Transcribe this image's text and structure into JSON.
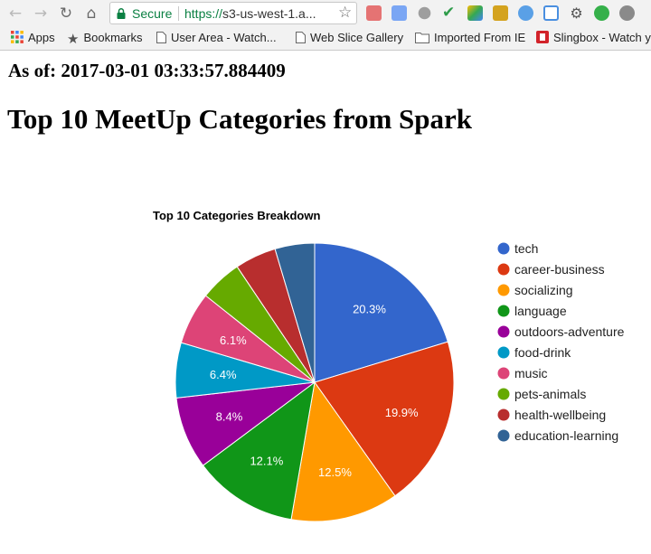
{
  "browser": {
    "secure_label": "Secure",
    "url_scheme": "https://",
    "url_rest": "s3-us-west-1.a...",
    "bookmarks": [
      "Apps",
      "Bookmarks",
      "User Area - Watch...",
      "Web Slice Gallery",
      "Imported From IE",
      "Slingbox - Watch y"
    ]
  },
  "page": {
    "timestamp": "As of: 2017-03-01 03:33:57.884409",
    "title": "Top 10 MeetUp Categories from Spark"
  },
  "chart_data": {
    "type": "pie",
    "title": "Top 10 Categories Breakdown",
    "legend_position": "right",
    "categories": [
      "tech",
      "career-business",
      "socializing",
      "language",
      "outdoors-adventure",
      "food-drink",
      "music",
      "pets-animals",
      "health-wellbeing",
      "education-learning"
    ],
    "values": [
      20.3,
      19.9,
      12.5,
      12.1,
      8.4,
      6.4,
      6.1,
      4.9,
      4.8,
      4.6
    ],
    "labels": [
      "20.3%",
      "19.9%",
      "12.5%",
      "12.1%",
      "8.4%",
      "6.4%",
      "6.1%",
      "",
      "",
      ""
    ],
    "colors": [
      "#3366cc",
      "#dc3912",
      "#ff9900",
      "#109618",
      "#990099",
      "#0099c6",
      "#dd4477",
      "#66aa00",
      "#b82e2e",
      "#316395"
    ]
  }
}
